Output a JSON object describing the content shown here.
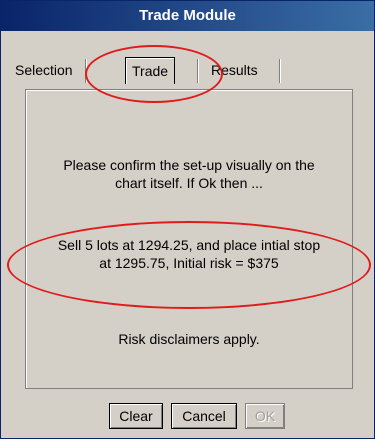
{
  "window": {
    "title": "Trade Module"
  },
  "tabs": [
    {
      "label": "Selection",
      "selected": false
    },
    {
      "label": "Trade",
      "selected": true
    },
    {
      "label": "Results",
      "selected": false
    }
  ],
  "panel": {
    "confirm_line1": "Please confirm the set-up visually on the",
    "confirm_line2": "chart itself.  If Ok then ...",
    "order_line1": "Sell 5 lots at 1294.25, and place intial stop",
    "order_line2": "at 1295.75, Initial risk = $375",
    "disclaimer": "Risk disclaimers apply."
  },
  "buttons": {
    "clear": "Clear",
    "cancel": "Cancel",
    "ok": "OK"
  },
  "colors": {
    "annotation": "#e11b1b",
    "titlebar": "#0a246a"
  }
}
